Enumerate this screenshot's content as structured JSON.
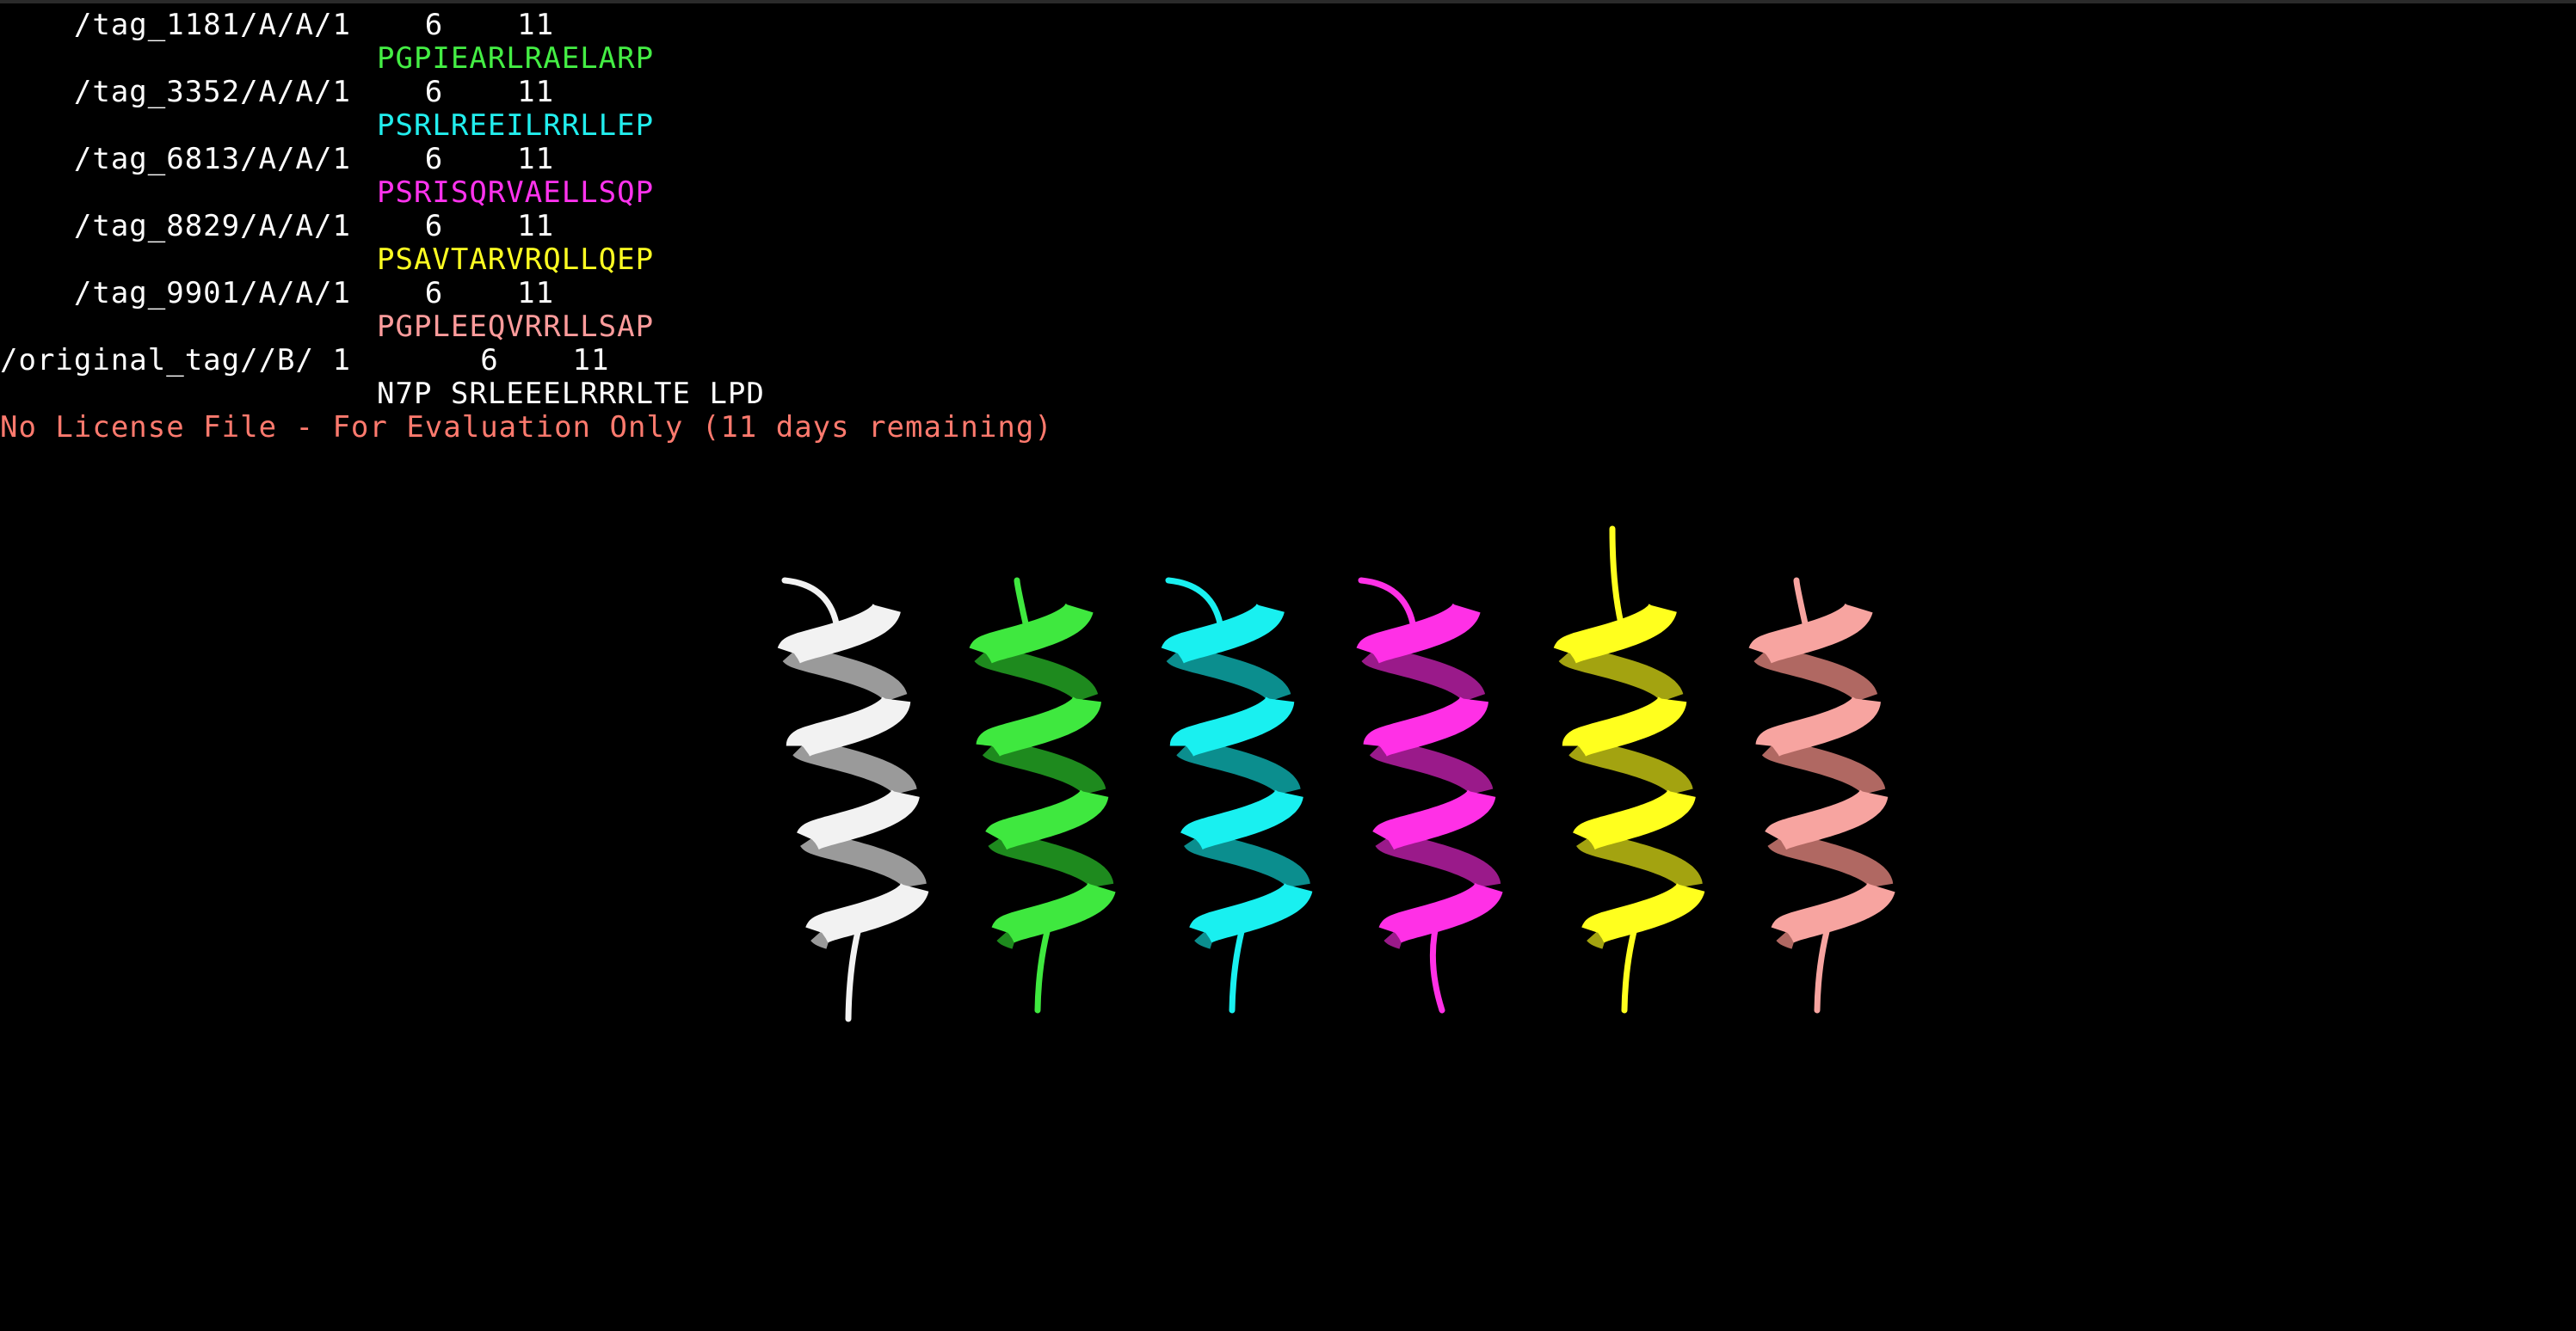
{
  "colors": {
    "background": "#000000",
    "header_text": "#ffffff",
    "license_text": "#ff7a6e"
  },
  "sequence_panel": {
    "rows": [
      {
        "header": "    /tag_1181/A/A/1    6    11",
        "sequence": "PGPIEARLRAELARP",
        "color": "#44ee44"
      },
      {
        "header": "    /tag_3352/A/A/1    6    11",
        "sequence": "PSRLREEILRRLLEP",
        "color": "#22eeee"
      },
      {
        "header": "    /tag_6813/A/A/1    6    11",
        "sequence": "PSRISQRVAELLSQP",
        "color": "#ff33ee"
      },
      {
        "header": "    /tag_8829/A/A/1    6    11",
        "sequence": "PSAVTARVRQLLQEP",
        "color": "#ffff22"
      },
      {
        "header": "    /tag_9901/A/A/1    6    11",
        "sequence": "PGPLEEQVRRLLSAP",
        "color": "#ff9c9c"
      },
      {
        "header": "/original_tag//B/ 1       6    11",
        "sequence": "N7P SRLEEELRRRLTE LPD",
        "color": "#ffffff"
      }
    ]
  },
  "license_message": "No License File - For Evaluation Only (11 days remaining)",
  "helices": [
    {
      "name": "original_tag",
      "color": "#f2f2f2",
      "shade": "#9a9a9a"
    },
    {
      "name": "tag_1181",
      "color": "#3fe83f",
      "shade": "#1e8a1e"
    },
    {
      "name": "tag_3352",
      "color": "#19f0f0",
      "shade": "#0b8e8e"
    },
    {
      "name": "tag_6813",
      "color": "#ff30e6",
      "shade": "#9a1a8a"
    },
    {
      "name": "tag_8829",
      "color": "#ffff1e",
      "shade": "#a3a310"
    },
    {
      "name": "tag_9901",
      "color": "#f7a4a0",
      "shade": "#b06862"
    }
  ]
}
